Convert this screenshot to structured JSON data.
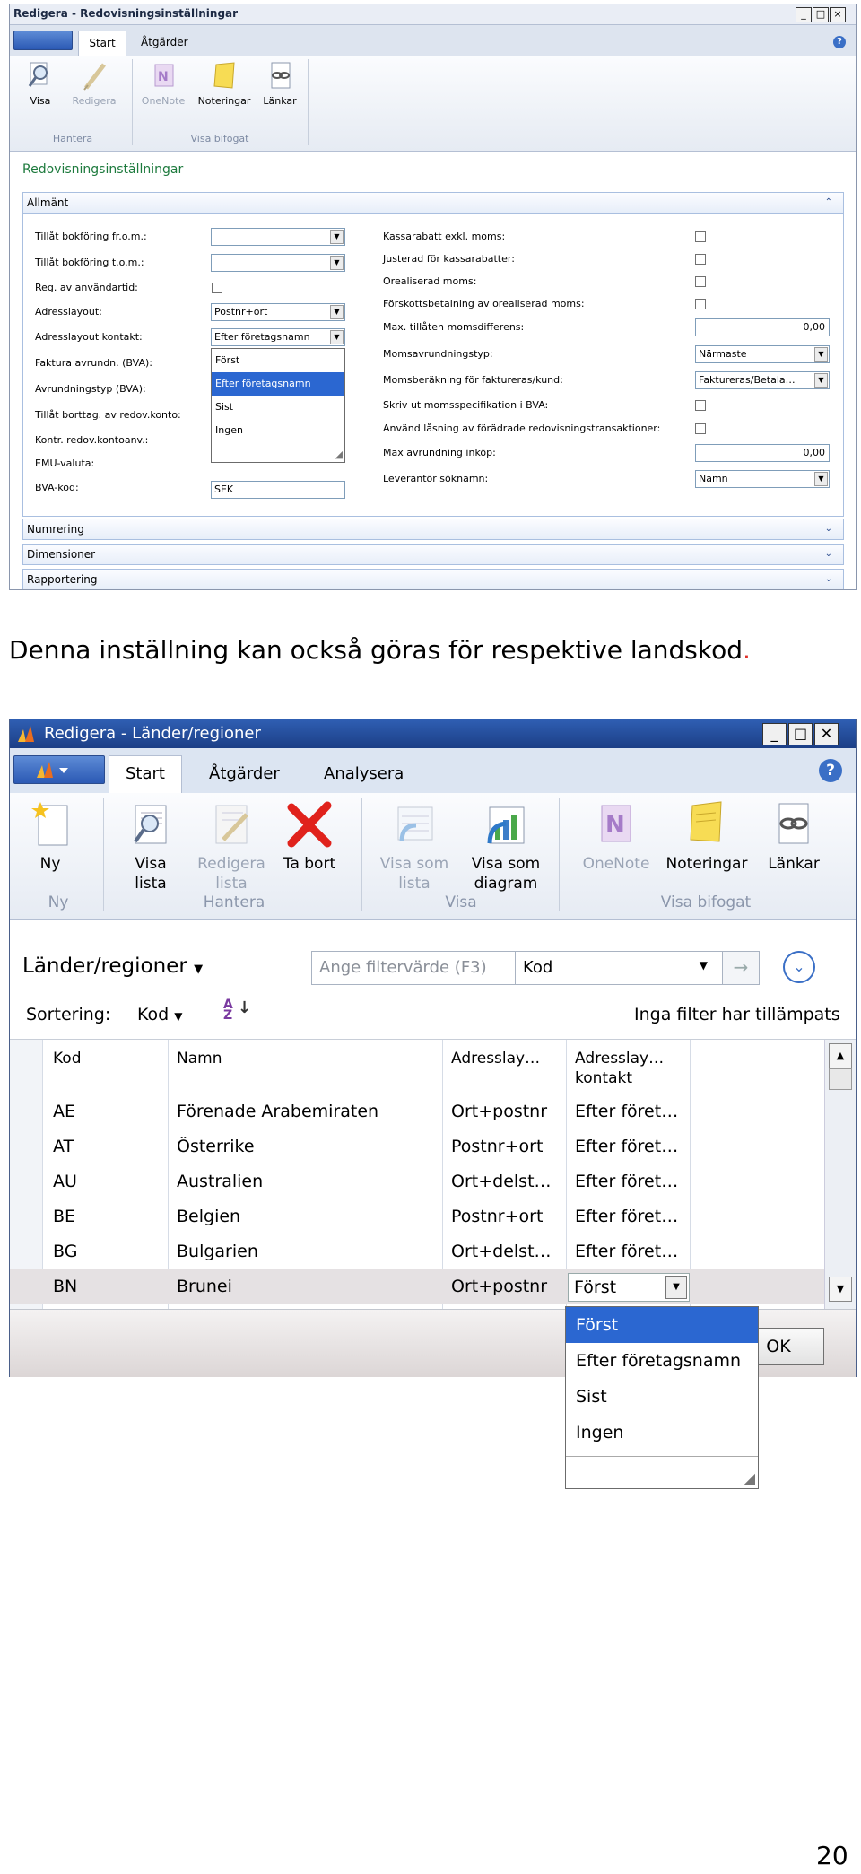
{
  "window1": {
    "title": "Redigera - Redovisningsinställningar",
    "tabs": [
      "Start",
      "Åtgärder"
    ],
    "ribbon": {
      "buttons": [
        {
          "label": "Visa",
          "icon": "magnifier-icon",
          "enabled": true
        },
        {
          "label": "Redigera",
          "icon": "pencil-icon",
          "enabled": false
        },
        {
          "label": "OneNote",
          "icon": "onenote-icon",
          "enabled": false
        },
        {
          "label": "Noteringar",
          "icon": "note-icon",
          "enabled": true
        },
        {
          "label": "Länkar",
          "icon": "link-icon",
          "enabled": true
        }
      ],
      "groups": [
        "Hantera",
        "Visa bifogat"
      ]
    },
    "page_title": "Redovisningsinställningar",
    "fasttabs": [
      "Allmänt",
      "Numrering",
      "Dimensioner",
      "Rapportering"
    ],
    "left_fields": [
      {
        "label": "Tillåt bokföring fr.o.m.:",
        "value": ""
      },
      {
        "label": "Tillåt bokföring t.o.m.:",
        "value": ""
      },
      {
        "label": "Reg. av användartid:",
        "value": ""
      },
      {
        "label": "Adresslayout:",
        "value": "Postnr+ort"
      },
      {
        "label": "Adresslayout kontakt:",
        "value": "Efter företagsnamn"
      },
      {
        "label": "Faktura avrundn. (BVA):",
        "value": ""
      },
      {
        "label": "Avrundningstyp (BVA):",
        "value": ""
      },
      {
        "label": "Tillåt borttag. av redov.konto:",
        "value": ""
      },
      {
        "label": "Kontr. redov.kontoanv.:",
        "value": ""
      },
      {
        "label": "EMU-valuta:",
        "value": ""
      },
      {
        "label": "BVA-kod:",
        "value": "SEK"
      }
    ],
    "right_fields": [
      {
        "label": "Kassarabatt exkl. moms:",
        "value": ""
      },
      {
        "label": "Justerad för kassarabatter:",
        "value": ""
      },
      {
        "label": "Orealiserad moms:",
        "value": ""
      },
      {
        "label": "Förskottsbetalning av orealiserad moms:",
        "value": ""
      },
      {
        "label": "Max. tillåten momsdifferens:",
        "value": "0,00"
      },
      {
        "label": "Momsavrundningstyp:",
        "value": "Närmaste"
      },
      {
        "label": "Momsberäkning för faktureras/kund:",
        "value": "Faktureras/Betala…"
      },
      {
        "label": "Skriv ut momsspecifikation i BVA:",
        "value": ""
      },
      {
        "label": "Använd låsning av förädrade redovisningstransaktioner:",
        "value": ""
      },
      {
        "label": "Max avrundning inköp:",
        "value": "0,00"
      },
      {
        "label": "Leverantör söknamn:",
        "value": "Namn"
      }
    ],
    "dropdown_options": [
      "Först",
      "Efter företagsnamn",
      "Sist",
      "Ingen"
    ],
    "dropdown_selected": "Efter företagsnamn"
  },
  "caption": {
    "text": "Denna inställning kan också göras för respektive landskod",
    "period": "."
  },
  "window2": {
    "title": "Redigera - Länder/regioner",
    "tabs": [
      "Start",
      "Åtgärder",
      "Analysera"
    ],
    "ribbon": {
      "buttons": [
        {
          "label": "Ny",
          "icon": "new-document-icon",
          "enabled": true
        },
        {
          "label": "Visa lista",
          "icon": "view-list-icon",
          "enabled": true
        },
        {
          "label": "Redigera lista",
          "icon": "edit-list-icon",
          "enabled": false
        },
        {
          "label": "Ta bort",
          "icon": "delete-icon",
          "enabled": true
        },
        {
          "label": "Visa som lista",
          "icon": "list-icon",
          "enabled": false
        },
        {
          "label": "Visa som diagram",
          "icon": "chart-icon",
          "enabled": true
        },
        {
          "label": "OneNote",
          "icon": "onenote-icon",
          "enabled": false
        },
        {
          "label": "Noteringar",
          "icon": "note-icon",
          "enabled": true
        },
        {
          "label": "Länkar",
          "icon": "link-icon",
          "enabled": true
        }
      ],
      "groups": [
        "Ny",
        "Hantera",
        "Visa",
        "Visa bifogat"
      ]
    },
    "list_title": "Länder/regioner",
    "filter_placeholder": "Ange filtervärde (F3)",
    "filter_field": "Kod",
    "sort_label": "Sortering:",
    "sort_field": "Kod",
    "filter_status": "Inga filter har tillämpats",
    "columns": [
      "Kod",
      "Namn",
      "Adresslay…",
      "Adresslay… kontakt"
    ],
    "rows": [
      [
        "AE",
        "Förenade Arabemiraten",
        "Ort+postnr",
        "Efter föret…"
      ],
      [
        "AT",
        "Österrike",
        "Postnr+ort",
        "Efter föret…"
      ],
      [
        "AU",
        "Australien",
        "Ort+delst…",
        "Efter föret…"
      ],
      [
        "BE",
        "Belgien",
        "Postnr+ort",
        "Efter föret…"
      ],
      [
        "BG",
        "Bulgarien",
        "Ort+delst…",
        "Efter föret…"
      ],
      [
        "BN",
        "Brunei",
        "Ort+postnr",
        "Först"
      ]
    ],
    "dropdown_options": [
      "Först",
      "Efter företagsnamn",
      "Sist",
      "Ingen"
    ],
    "dropdown_selected": "Först",
    "ok_label": "OK"
  },
  "page_number": "20",
  "colors": {
    "selection": "#2b67d1",
    "caption_period": "#e0312a",
    "title_bar": "#2f5fb3"
  }
}
